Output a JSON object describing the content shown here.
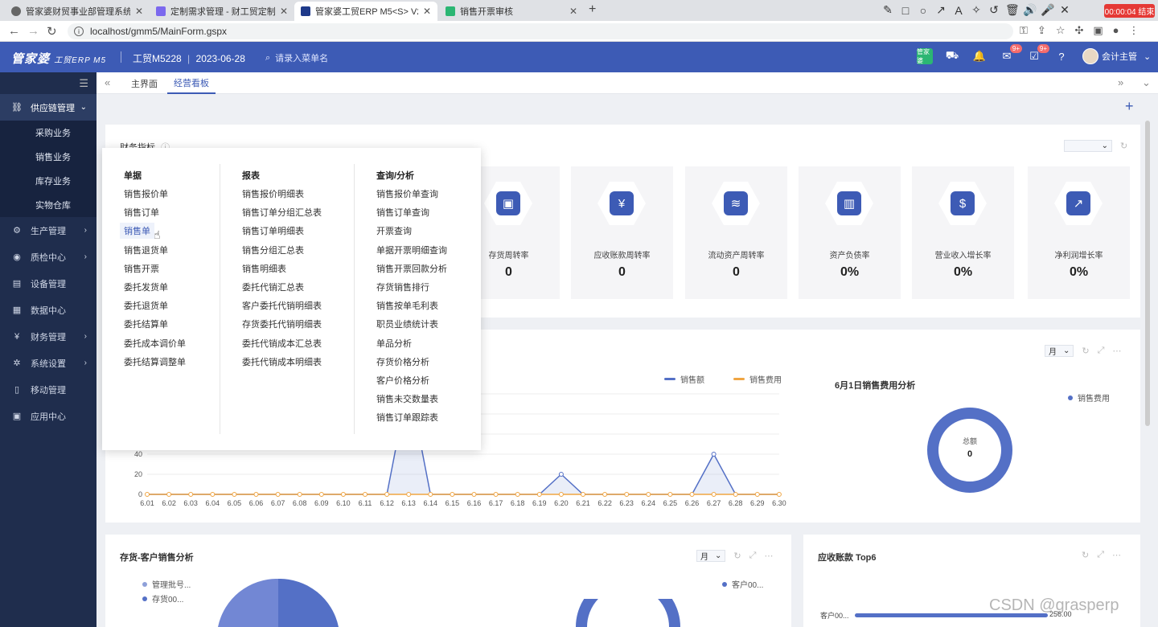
{
  "browser": {
    "tabs": [
      {
        "label": "管家婆财贸事业部管理系统",
        "color": "#555"
      },
      {
        "label": "定制需求管理 - 财工贸定制开发",
        "color": "#7b68ee"
      },
      {
        "label": "管家婆工贸ERP M5<S> V22.8-",
        "color": "#1f3a8a"
      },
      {
        "label": "销售开票审核",
        "color": "#2bb673"
      }
    ],
    "url": "localhost/gmm5/MainForm.gspx",
    "recording": "00:00:04 结束"
  },
  "header": {
    "logo": "管家婆",
    "logo_sub": "工贸ERP M5",
    "company": "工贸M5228",
    "date": "2023-06-28",
    "search_placeholder": "请录入菜单名",
    "badge1": "9+",
    "badge2": "9+",
    "user": "会计主管",
    "green_icon": "管家婆"
  },
  "sidebar": {
    "items": [
      {
        "label": "供应链管理",
        "icon": "⛓"
      },
      {
        "label": "生产管理",
        "icon": "⚙"
      },
      {
        "label": "质检中心",
        "icon": "◉"
      },
      {
        "label": "设备管理",
        "icon": "▤"
      },
      {
        "label": "数据中心",
        "icon": "▦"
      },
      {
        "label": "财务管理",
        "icon": "¥"
      },
      {
        "label": "系统设置",
        "icon": "✲"
      },
      {
        "label": "移动管理",
        "icon": "▯"
      },
      {
        "label": "应用中心",
        "icon": "▣"
      }
    ],
    "sub": [
      "采购业务",
      "销售业务",
      "库存业务",
      "实物仓库"
    ]
  },
  "content_tabs": [
    "主界面",
    "经营看板"
  ],
  "finance": {
    "title": "财务指标",
    "kpis": [
      {
        "label": "存货周转率",
        "value": "0",
        "icon": "▣"
      },
      {
        "label": "应收账款周转率",
        "value": "0",
        "icon": "¥"
      },
      {
        "label": "流动资产周转率",
        "value": "0",
        "icon": "≋"
      },
      {
        "label": "资产负债率",
        "value": "0%",
        "icon": "▥"
      },
      {
        "label": "营业收入增长率",
        "value": "0%",
        "icon": "$"
      },
      {
        "label": "净利润增长率",
        "value": "0%",
        "icon": "↗"
      }
    ]
  },
  "sales_chart": {
    "period": "月",
    "legend": [
      "销售额",
      "销售费用"
    ],
    "pie_title": "6月1日销售费用分析",
    "pie_legend": "销售费用",
    "pie_center_label": "总额",
    "pie_center_value": "0"
  },
  "chart_data": {
    "type": "line",
    "x": [
      "6.01",
      "6.02",
      "6.03",
      "6.04",
      "6.05",
      "6.06",
      "6.07",
      "6.08",
      "6.09",
      "6.10",
      "6.11",
      "6.12",
      "6.13",
      "6.14",
      "6.15",
      "6.16",
      "6.17",
      "6.18",
      "6.19",
      "6.20",
      "6.21",
      "6.22",
      "6.23",
      "6.24",
      "6.25",
      "6.26",
      "6.27",
      "6.28",
      "6.29",
      "6.30"
    ],
    "series": [
      {
        "name": "销售额",
        "values": [
          0,
          0,
          0,
          0,
          0,
          0,
          0,
          0,
          0,
          0,
          0,
          0,
          120,
          0,
          0,
          0,
          0,
          0,
          0,
          20,
          0,
          0,
          0,
          0,
          0,
          0,
          40,
          0,
          0,
          0
        ]
      },
      {
        "name": "销售费用",
        "values": [
          0,
          0,
          0,
          0,
          0,
          0,
          0,
          0,
          0,
          0,
          0,
          0,
          0,
          0,
          0,
          0,
          0,
          0,
          0,
          0,
          0,
          0,
          0,
          0,
          0,
          0,
          0,
          0,
          0,
          0
        ]
      }
    ],
    "yticks": [
      "0",
      "20",
      "40"
    ],
    "ylim": [
      0,
      40
    ],
    "colors": [
      "#5470c6",
      "#f0a542"
    ]
  },
  "inventory": {
    "title": "存货-客户销售分析",
    "period": "月",
    "legend": [
      "管理批号...",
      "存货00..."
    ],
    "legend2": "客户00..."
  },
  "receivable": {
    "title": "应收账款 Top6",
    "row_label": "客户00...",
    "row_value": "256.00"
  },
  "mega_menu": {
    "columns": [
      {
        "title": "单据",
        "items": [
          "销售报价单",
          "销售订单",
          "销售单",
          "销售退货单",
          "销售开票",
          "委托发货单",
          "委托退货单",
          "委托结算单",
          "委托成本调价单",
          "委托结算调整单"
        ]
      },
      {
        "title": "报表",
        "items": [
          "销售报价明细表",
          "销售订单分组汇总表",
          "销售订单明细表",
          "销售分组汇总表",
          "销售明细表",
          "委托代销汇总表",
          "客户委托代销明细表",
          "存货委托代销明细表",
          "委托代销成本汇总表",
          "委托代销成本明细表"
        ]
      },
      {
        "title": "查询/分析",
        "items": [
          "销售报价单查询",
          "销售订单查询",
          "开票查询",
          "单据开票明细查询",
          "销售开票回款分析",
          "存货销售排行",
          "销售按单毛利表",
          "职员业绩统计表",
          "单品分析",
          "存货价格分析",
          "客户价格分析",
          "销售未交数量表",
          "销售订单跟踪表"
        ]
      }
    ]
  },
  "watermark": "CSDN @grasperp"
}
